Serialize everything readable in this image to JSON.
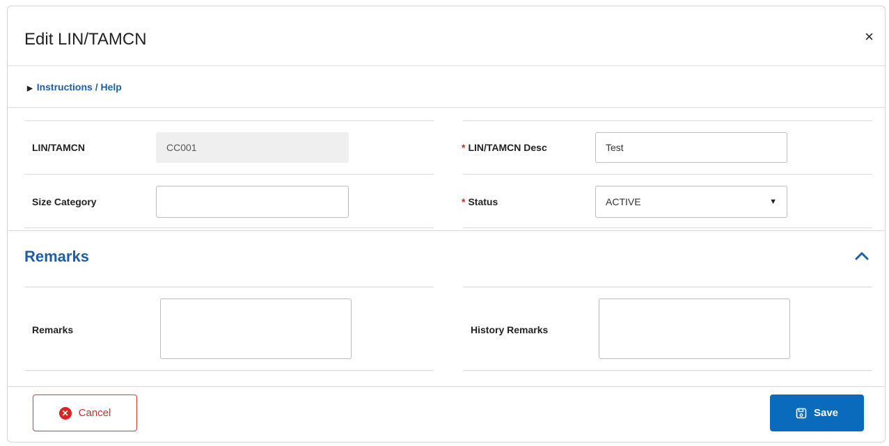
{
  "dialog": {
    "title": "Edit LIN/TAMCN",
    "close_glyph": "×"
  },
  "help": {
    "label": "Instructions / Help"
  },
  "fields": {
    "lin_tamcn": {
      "label": "LIN/TAMCN",
      "value": "CC001"
    },
    "lin_tamcn_desc": {
      "label": "LIN/TAMCN Desc",
      "value": "Test",
      "required": true
    },
    "size_category": {
      "label": "Size Category",
      "value": ""
    },
    "status": {
      "label": "Status",
      "value": "ACTIVE",
      "required": true
    }
  },
  "remarks_section": {
    "title": "Remarks",
    "remarks_label": "Remarks",
    "history_remarks_label": "History Remarks"
  },
  "actions": {
    "cancel": "Cancel",
    "save": "Save"
  },
  "colors": {
    "accent": "#0a6bbd",
    "link": "#1d5fa6",
    "danger": "#d22222"
  }
}
